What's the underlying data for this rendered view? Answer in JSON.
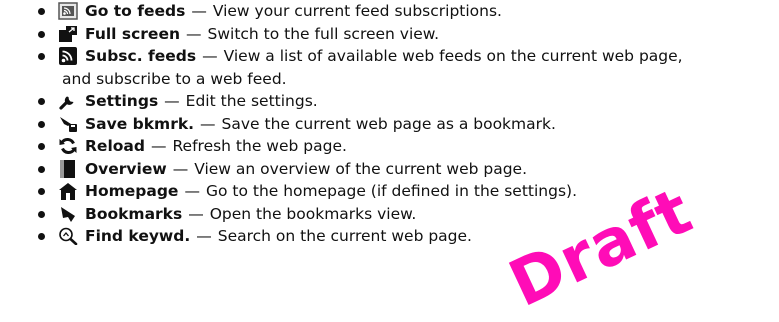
{
  "items": [
    {
      "icon": "feeds-icon",
      "label": "Go to feeds",
      "sep": "—",
      "desc": "View your current feed subscriptions."
    },
    {
      "icon": "full-screen-icon",
      "label": "Full screen",
      "sep": "—",
      "desc": "Switch to the full screen view."
    },
    {
      "icon": "rss-icon",
      "label": "Subsc. feeds",
      "sep": "—",
      "desc": "View a list of available web feeds on the current web page,",
      "desc2": "and subscribe to a web feed."
    },
    {
      "icon": "wrench-icon",
      "label": "Settings",
      "sep": "—",
      "desc": "Edit the settings."
    },
    {
      "icon": "save-bookmark-icon",
      "label": "Save bkmrk.",
      "sep": "—",
      "desc": "Save the current web page as a bookmark."
    },
    {
      "icon": "reload-icon",
      "label": "Reload",
      "sep": "—",
      "desc": "Refresh the web page."
    },
    {
      "icon": "overview-icon",
      "label": "Overview",
      "sep": "—",
      "desc": "View an overview of the current web page."
    },
    {
      "icon": "home-icon",
      "label": "Homepage",
      "sep": "—",
      "desc": "Go to the homepage (if defined in the settings)."
    },
    {
      "icon": "bookmark-icon",
      "label": "Bookmarks",
      "sep": "—",
      "desc": "Open the bookmarks view."
    },
    {
      "icon": "find-keyword-icon",
      "label": "Find keywd.",
      "sep": "—",
      "desc": "Search on the current web page."
    }
  ],
  "watermark": "Draft",
  "colors": {
    "text": "#111111",
    "watermark": "#ff00b4"
  }
}
